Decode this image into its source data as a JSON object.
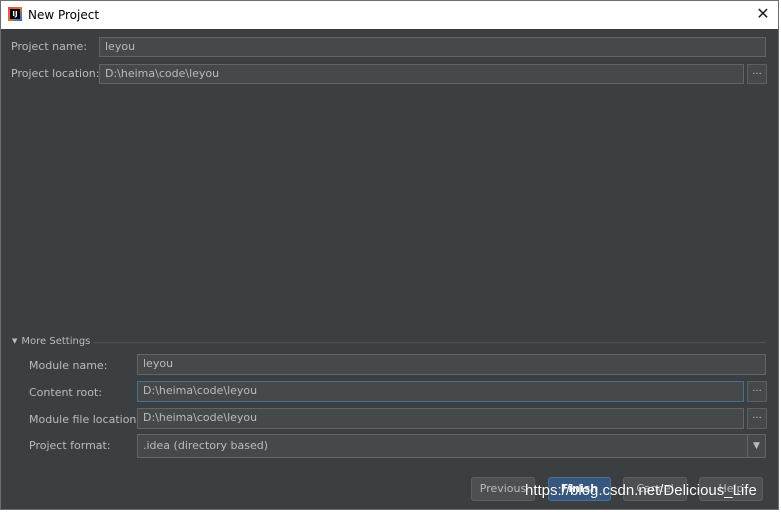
{
  "titlebar": {
    "title": "New Project",
    "close_glyph": "✕",
    "app_icon": "intellij-idea-icon"
  },
  "project": {
    "name_label": "Project name:",
    "name_value": "leyou",
    "location_label": "Project location:",
    "location_value": "D:\\heima\\code\\leyou",
    "browse_glyph": "..."
  },
  "more_settings": {
    "toggle_glyph": "▼",
    "label": "More Settings",
    "expanded": true,
    "module_name_label": "Module name:",
    "module_name_value": "leyou",
    "content_root_label": "Content root:",
    "content_root_value": "D:\\heima\\code\\leyou",
    "module_file_label": "Module file location:",
    "module_file_value": "D:\\heima\\code\\leyou",
    "project_format_label": "Project format:",
    "project_format_value": ".idea (directory based)",
    "select_arrow_glyph": "▼",
    "browse_glyph": "..."
  },
  "buttons": {
    "previous": "Previous",
    "finish": "Finish",
    "cancel": "Cancel",
    "help": "Help"
  },
  "watermark": "https://blog.csdn.net/Delicious_Life",
  "colors": {
    "background": "#3c3f41",
    "field": "#45494a",
    "primary_button": "#365880",
    "focus_border": "#466d94"
  }
}
